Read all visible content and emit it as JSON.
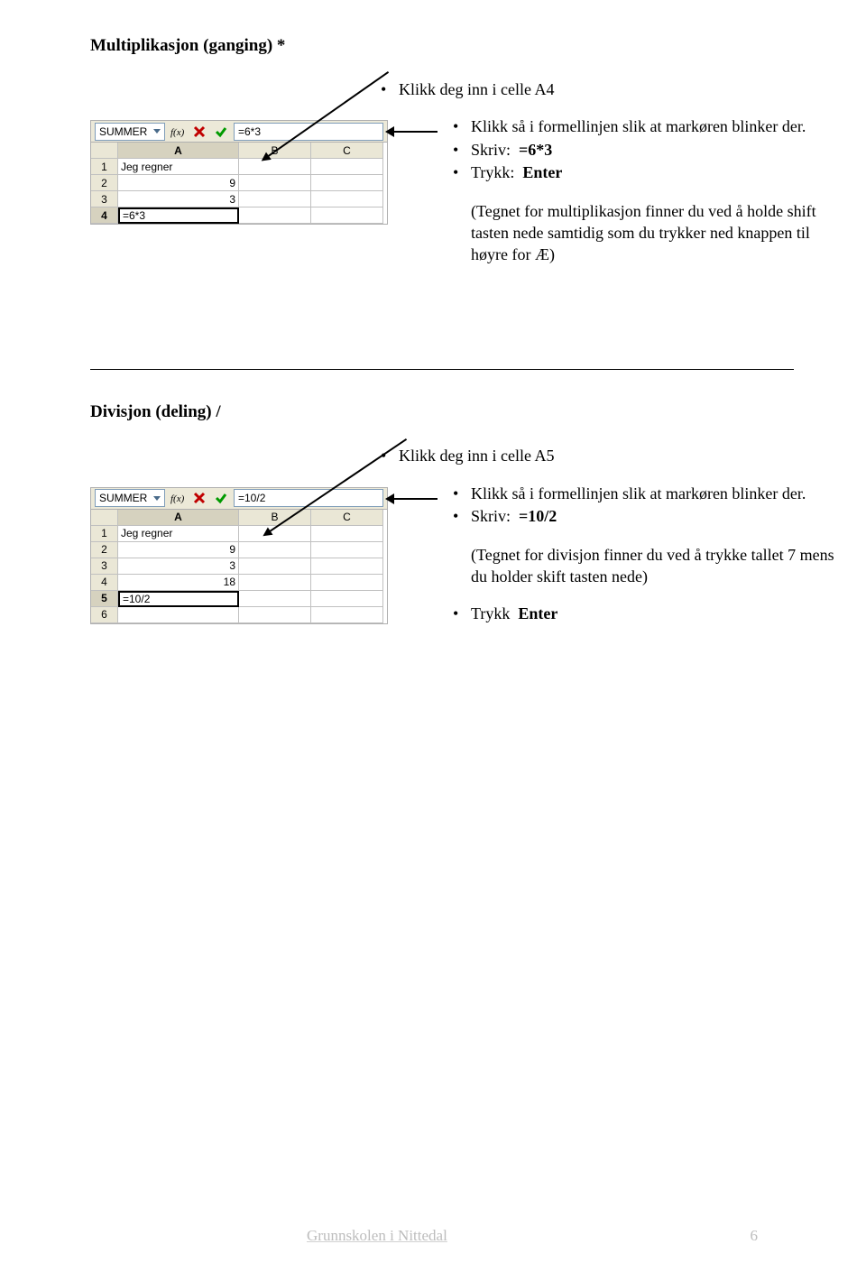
{
  "section1": {
    "heading": "Multiplikasjon (ganging) *",
    "intro_bullet": "Klikk deg inn i celle A4",
    "bullets": [
      "Klikk så i formellinjen slik at markøren blinker der.",
      "Skriv:  =6*3",
      "Trykk:  Enter"
    ],
    "bold_in_b2": "=6*3",
    "bold_in_b3": "Enter",
    "note": "(Tegnet for multiplikasjon finner du ved å holde shift tasten nede samtidig som du trykker ned knappen til høyre for Æ)",
    "shot": {
      "namebox": "SUMMER",
      "formula": "=6*3",
      "cols": [
        "A",
        "B",
        "C"
      ],
      "rows": [
        {
          "r": "1",
          "a": "Jeg regner",
          "b": "",
          "c": ""
        },
        {
          "r": "2",
          "a": "9",
          "b": "",
          "c": ""
        },
        {
          "r": "3",
          "a": "3",
          "b": "",
          "c": ""
        },
        {
          "r": "4",
          "a": "=6*3",
          "b": "",
          "c": ""
        }
      ],
      "active_row": "4",
      "active_col": "A"
    }
  },
  "section2": {
    "heading": "Divisjon (deling)  /",
    "intro_bullet": "Klikk deg inn i celle A5",
    "bullets": [
      "Klikk så i formellinjen slik at markøren blinker der.",
      "Skriv:  =10/2"
    ],
    "bold_in_b2": "=10/2",
    "note": "(Tegnet for divisjon finner du ved å trykke tallet 7 mens du holder skift tasten nede)",
    "last_bullet": "Trykk  Enter",
    "bold_in_last": "Enter",
    "shot": {
      "namebox": "SUMMER",
      "formula": "=10/2",
      "cols": [
        "A",
        "B",
        "C"
      ],
      "rows": [
        {
          "r": "1",
          "a": "Jeg regner",
          "b": "",
          "c": ""
        },
        {
          "r": "2",
          "a": "9",
          "b": "",
          "c": ""
        },
        {
          "r": "3",
          "a": "3",
          "b": "",
          "c": ""
        },
        {
          "r": "4",
          "a": "18",
          "b": "",
          "c": ""
        },
        {
          "r": "5",
          "a": "=10/2",
          "b": "",
          "c": ""
        },
        {
          "r": "6",
          "a": "",
          "b": "",
          "c": ""
        }
      ],
      "active_row": "5",
      "active_col": "A"
    }
  },
  "footer": {
    "center": "Grunnskolen i Nittedal",
    "page": "6"
  },
  "icons": {
    "fx": "f(x)",
    "cancel": "cancel-icon",
    "accept": "accept-icon"
  }
}
